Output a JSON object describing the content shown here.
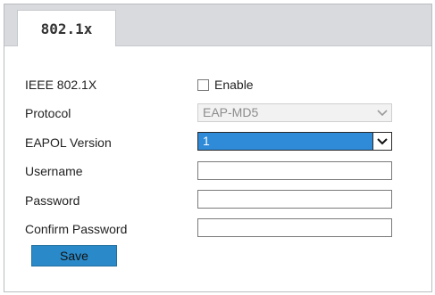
{
  "tabs": [
    {
      "label": "802.1x",
      "active": true
    }
  ],
  "form": {
    "ieee": {
      "label": "IEEE 802.1X",
      "checkbox_label": "Enable",
      "checked": false
    },
    "protocol": {
      "label": "Protocol",
      "value": "EAP-MD5",
      "disabled": true
    },
    "eapol": {
      "label": "EAPOL Version",
      "value": "1"
    },
    "username": {
      "label": "Username",
      "value": ""
    },
    "password": {
      "label": "Password",
      "value": ""
    },
    "confirm": {
      "label": "Confirm Password",
      "value": ""
    }
  },
  "actions": {
    "save_label": "Save"
  },
  "colors": {
    "tabbar_bg": "#d8dadd",
    "button_blue": "#2a8ac9",
    "select_highlight": "#2f8ad8"
  }
}
